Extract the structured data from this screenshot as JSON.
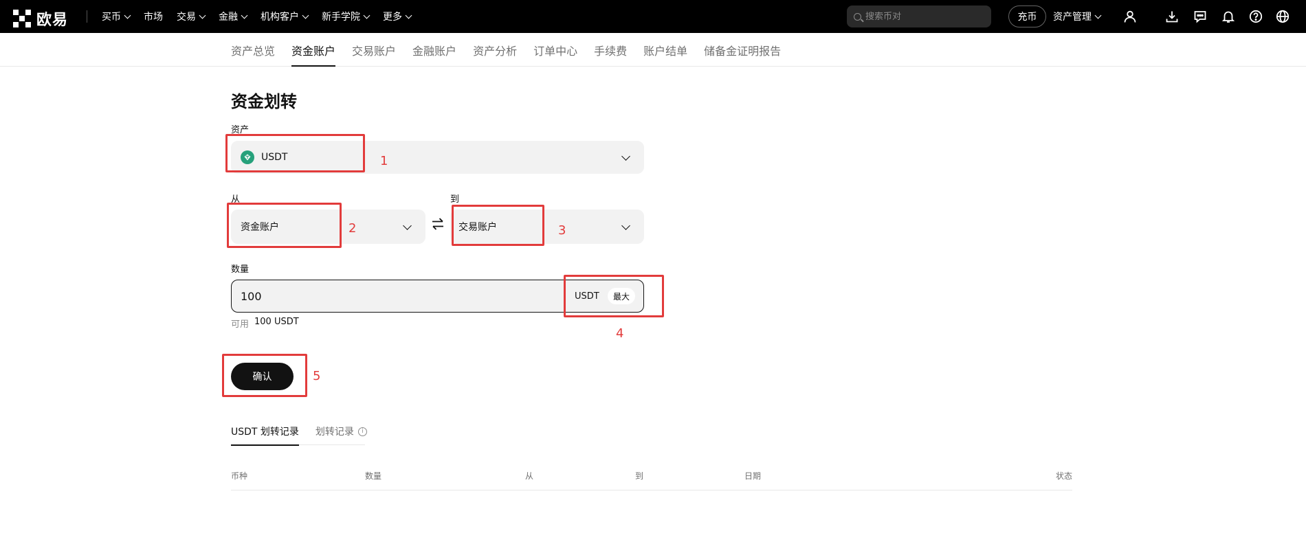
{
  "brand": {
    "name": "欧易"
  },
  "topnav": {
    "menu": [
      {
        "label": "买币",
        "dropdown": true
      },
      {
        "label": "市场",
        "dropdown": false
      },
      {
        "label": "交易",
        "dropdown": true
      },
      {
        "label": "金融",
        "dropdown": true
      },
      {
        "label": "机构客户",
        "dropdown": true
      },
      {
        "label": "新手学院",
        "dropdown": true
      },
      {
        "label": "更多",
        "dropdown": true
      }
    ],
    "search_placeholder": "搜索币对",
    "deposit_label": "充币",
    "asset_mgmt_label": "资产管理",
    "icons": [
      "user-icon",
      "download-icon",
      "message-icon",
      "bell-icon",
      "help-icon",
      "globe-icon"
    ]
  },
  "subnav": {
    "tabs": [
      "资产总览",
      "资金账户",
      "交易账户",
      "金融账户",
      "资产分析",
      "订单中心",
      "手续费",
      "账户结单",
      "储备金证明报告"
    ],
    "active_index": 1
  },
  "form": {
    "title": "资金划转",
    "asset_label": "资产",
    "asset_value": "USDT",
    "from_label": "从",
    "from_value": "资金账户",
    "to_label": "到",
    "to_value": "交易账户",
    "amount_label": "数量",
    "amount_value": "100",
    "amount_unit": "USDT",
    "max_label": "最大",
    "available_label": "可用",
    "available_value": "100 USDT",
    "confirm_label": "确认"
  },
  "annotations": [
    "1",
    "2",
    "3",
    "4",
    "5"
  ],
  "records": {
    "tabs": [
      "USDT 划转记录",
      "划转记录"
    ],
    "active_index": 0,
    "columns": [
      "币种",
      "数量",
      "从",
      "到",
      "日期",
      "状态"
    ]
  },
  "colors": {
    "annotation": "#e23b3b",
    "usdt": "#26a17b",
    "nav_bg": "#000000"
  }
}
